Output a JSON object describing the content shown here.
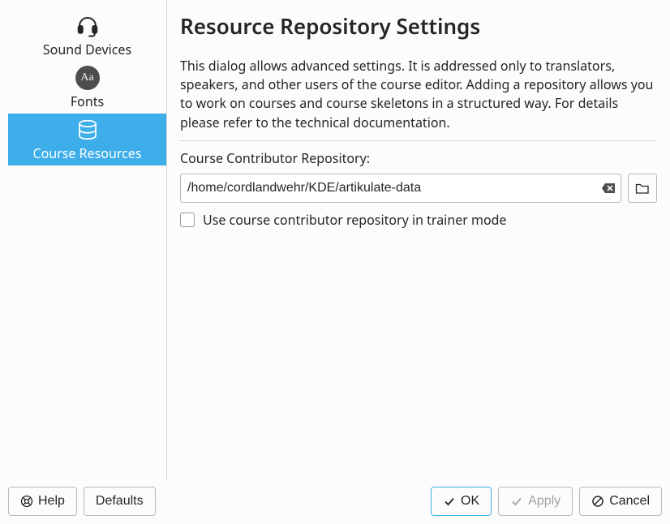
{
  "sidebar": {
    "items": [
      {
        "label": "Sound Devices"
      },
      {
        "label": "Fonts"
      },
      {
        "label": "Course Resources"
      }
    ]
  },
  "main": {
    "title": "Resource Repository Settings",
    "description": "This dialog allows advanced settings. It is addressed only to translators, speakers, and other users of the course editor. Adding a repository allows you to work on courses and course skeletons in a structured way. For details please refer to the technical documentation.",
    "repo_label": "Course Contributor Repository:",
    "repo_path": "/home/cordlandwehr/KDE/artikulate-data",
    "checkbox_label": "Use course contributor repository in trainer mode"
  },
  "buttons": {
    "help": "Help",
    "defaults": "Defaults",
    "ok": "OK",
    "apply": "Apply",
    "cancel": "Cancel"
  },
  "icons": {
    "font_badge": "Aa"
  }
}
